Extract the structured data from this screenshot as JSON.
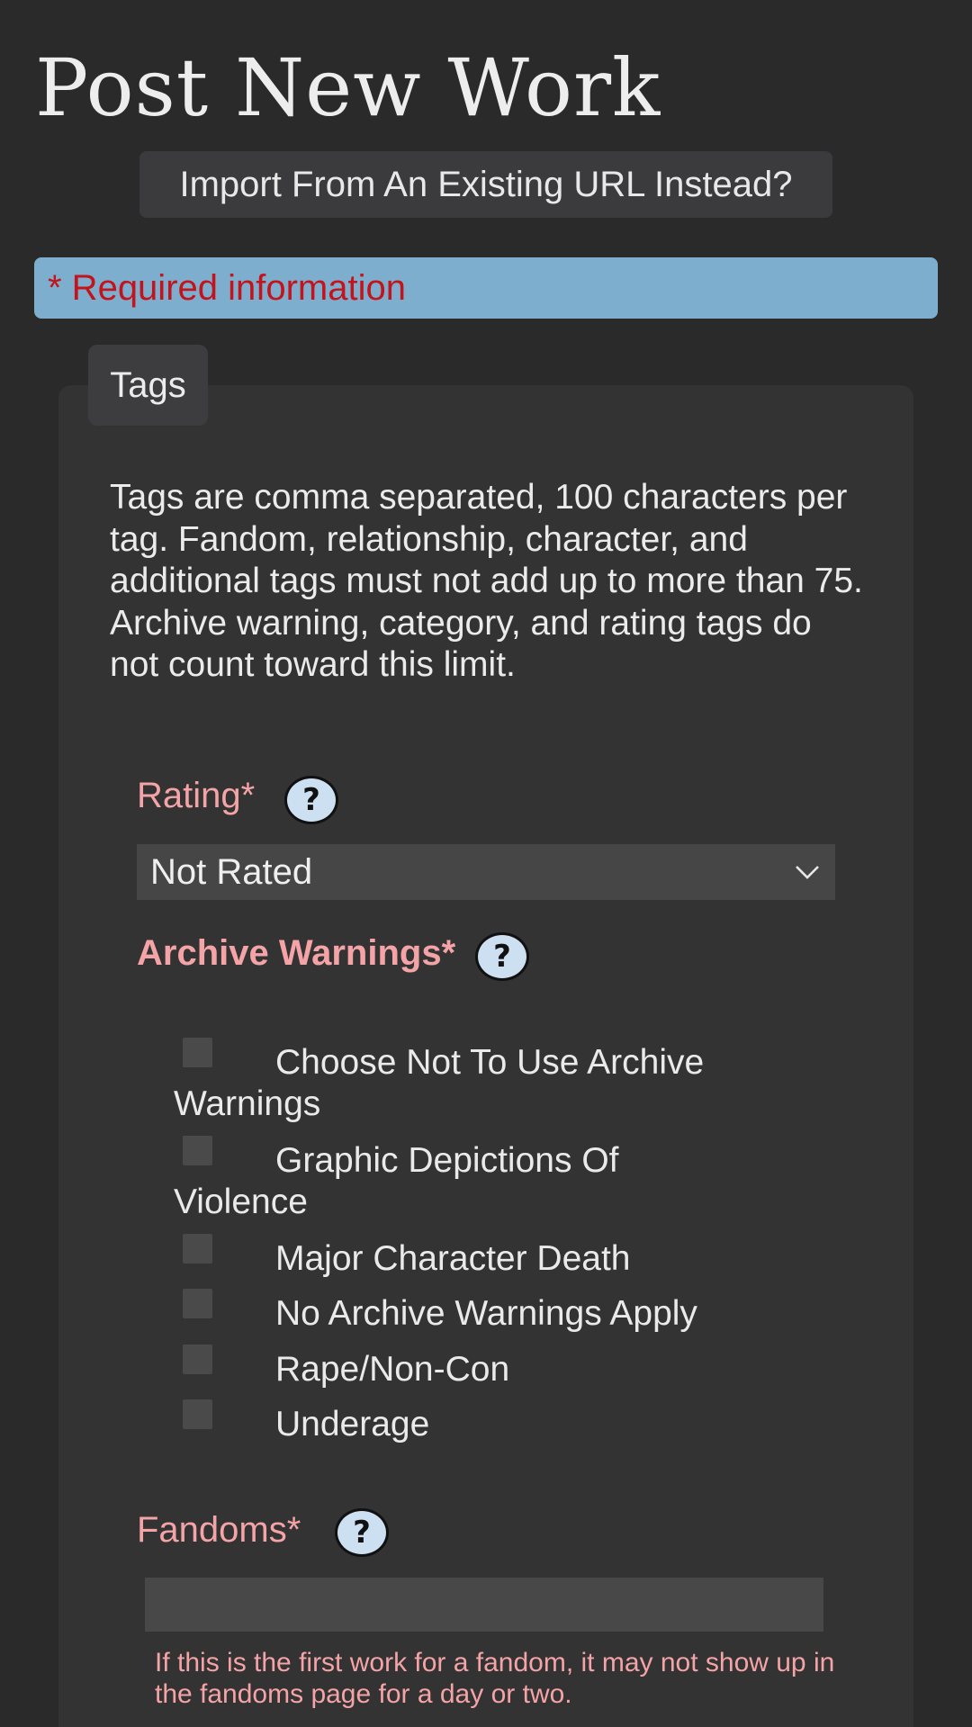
{
  "page_title": "Post New Work",
  "import_button_label": "Import From An Existing URL Instead?",
  "required_notice": "* Required information",
  "tags_tab_label": "Tags",
  "tags_description": "Tags are comma separated, 100 characters per tag. Fandom, relationship, character, and additional tags must not add up to more than 75. Archive warning, category, and rating tags do not count toward this limit.",
  "rating": {
    "label": "Rating*",
    "selected": "Not Rated",
    "help_glyph": "?"
  },
  "archive_warnings": {
    "label": "Archive Warnings*",
    "help_glyph": "?",
    "items": [
      {
        "line1": "Choose Not To Use Archive",
        "line2": "Warnings",
        "checked": false
      },
      {
        "line1": "Graphic Depictions Of",
        "line2": "Violence",
        "checked": false
      },
      {
        "line1": "Major Character Death",
        "line2": "",
        "checked": false
      },
      {
        "line1": "No Archive Warnings Apply",
        "line2": "",
        "checked": false
      },
      {
        "line1": "Rape/Non-Con",
        "line2": "",
        "checked": false
      },
      {
        "line1": "Underage",
        "line2": "",
        "checked": false
      }
    ]
  },
  "fandoms": {
    "label": "Fandoms*",
    "help_glyph": "?",
    "value": "",
    "note": "If this is the first work for a fandom, it may not show up in the fandoms page for a day or two."
  },
  "colors": {
    "background": "#2a2a2b",
    "panel": "#333334",
    "banner": "#7eaecd",
    "required_red": "#c3141d",
    "label_pink": "#f4a3a6",
    "help_icon_fill": "#cde0f1"
  },
  "icons": {
    "help": "question-mark-circle-icon",
    "dropdown": "chevron-down-icon",
    "checkbox": "checkbox-icon"
  }
}
